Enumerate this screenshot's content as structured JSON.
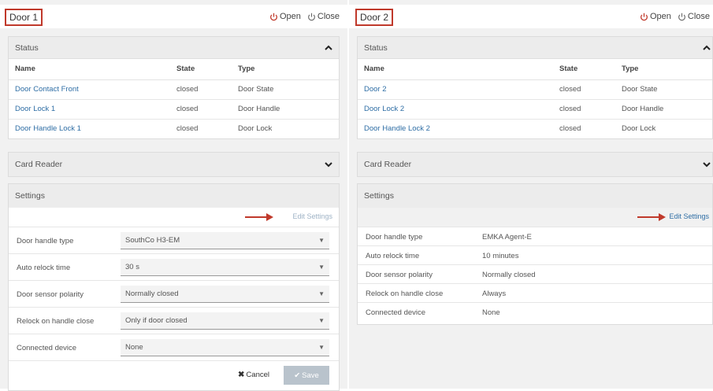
{
  "colors": {
    "accent_red": "#c0392b",
    "link_blue": "#2f6ea5",
    "save_disabled": "#b9c3cc"
  },
  "header_actions": {
    "open_label": "Open",
    "close_label": "Close"
  },
  "status_columns": {
    "name": "Name",
    "state": "State",
    "type": "Type"
  },
  "section_titles": {
    "status": "Status",
    "card_reader": "Card Reader",
    "settings": "Settings"
  },
  "edit_settings_label": "Edit Settings",
  "door1": {
    "title": "Door 1",
    "status_rows": [
      {
        "name": "Door Contact Front",
        "state": "closed",
        "type": "Door State"
      },
      {
        "name": "Door Lock 1",
        "state": "closed",
        "type": "Door Handle"
      },
      {
        "name": "Door Handle Lock 1",
        "state": "closed",
        "type": "Door Lock"
      }
    ],
    "settings": [
      {
        "label": "Door handle type",
        "value": "SouthCo H3-EM"
      },
      {
        "label": "Auto relock time",
        "value": "30 s"
      },
      {
        "label": "Door sensor polarity",
        "value": "Normally closed"
      },
      {
        "label": "Relock on handle close",
        "value": "Only if door closed"
      },
      {
        "label": "Connected device",
        "value": "None"
      }
    ],
    "cancel_label": "Cancel",
    "save_label": "Save"
  },
  "door2": {
    "title": "Door 2",
    "status_rows": [
      {
        "name": "Door 2",
        "state": "closed",
        "type": "Door State"
      },
      {
        "name": "Door Lock 2",
        "state": "closed",
        "type": "Door Handle"
      },
      {
        "name": "Door Handle Lock 2",
        "state": "closed",
        "type": "Door Lock"
      }
    ],
    "settings": [
      {
        "label": "Door handle type",
        "value": "EMKA Agent-E"
      },
      {
        "label": "Auto relock time",
        "value": "10 minutes"
      },
      {
        "label": "Door sensor polarity",
        "value": "Normally closed"
      },
      {
        "label": "Relock on handle close",
        "value": "Always"
      },
      {
        "label": "Connected device",
        "value": "None"
      }
    ]
  }
}
